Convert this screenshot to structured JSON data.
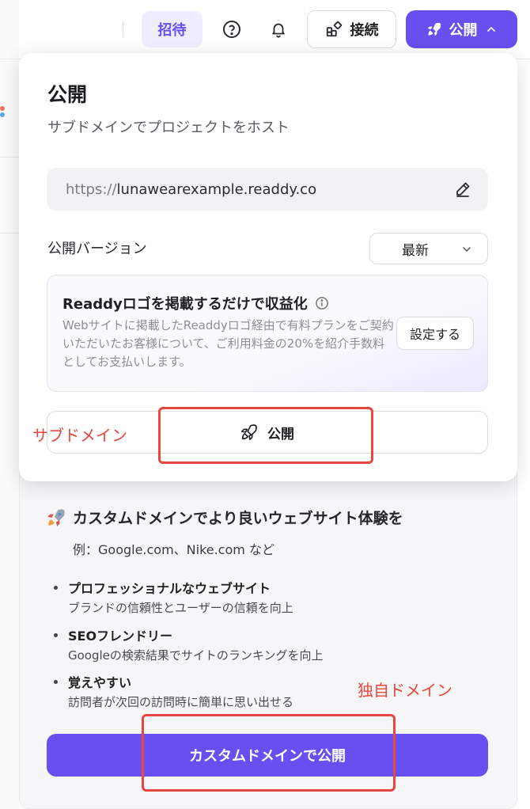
{
  "topbar": {
    "invite_label": "招待",
    "connect_label": "接続",
    "publish_label": "公開"
  },
  "popover": {
    "title": "公開",
    "subtitle": "サブドメインでプロジェクトをホスト",
    "url_prefix": "https://",
    "url_domain": "lunawearexample.readdy.co",
    "version_label": "公開バージョン",
    "version_value": "最新",
    "monetize": {
      "title": "Readdyロゴを掲載するだけで収益化",
      "description": "Webサイトに掲載したReaddyロゴ経由で有料プランをご契約いただいたお客様について、ご利用料金の20%を紹介手数料としてお支払いします。",
      "settings_label": "設定する"
    },
    "publish_button_label": "公開"
  },
  "promo": {
    "title": "カスタムドメインでより良いウェブサイト体験を",
    "example": "例：Google.com、Nike.com など",
    "benefits": [
      {
        "title": "プロフェッショナルなウェブサイト",
        "desc": "ブランドの信頼性とユーザーの信頼を向上"
      },
      {
        "title": "SEOフレンドリー",
        "desc": "Googleの検索結果でサイトのランキングを向上"
      },
      {
        "title": "覚えやすい",
        "desc": "訪問者が次回の訪問時に簡単に思い出せる"
      }
    ],
    "custom_domain_button_label": "カスタムドメインで公開"
  },
  "annotations": {
    "subdomain": "サブドメイン",
    "custom_domain": "独自ドメイン"
  },
  "colors": {
    "accent": "#6a4ff0",
    "annotation": "#e8463f"
  }
}
